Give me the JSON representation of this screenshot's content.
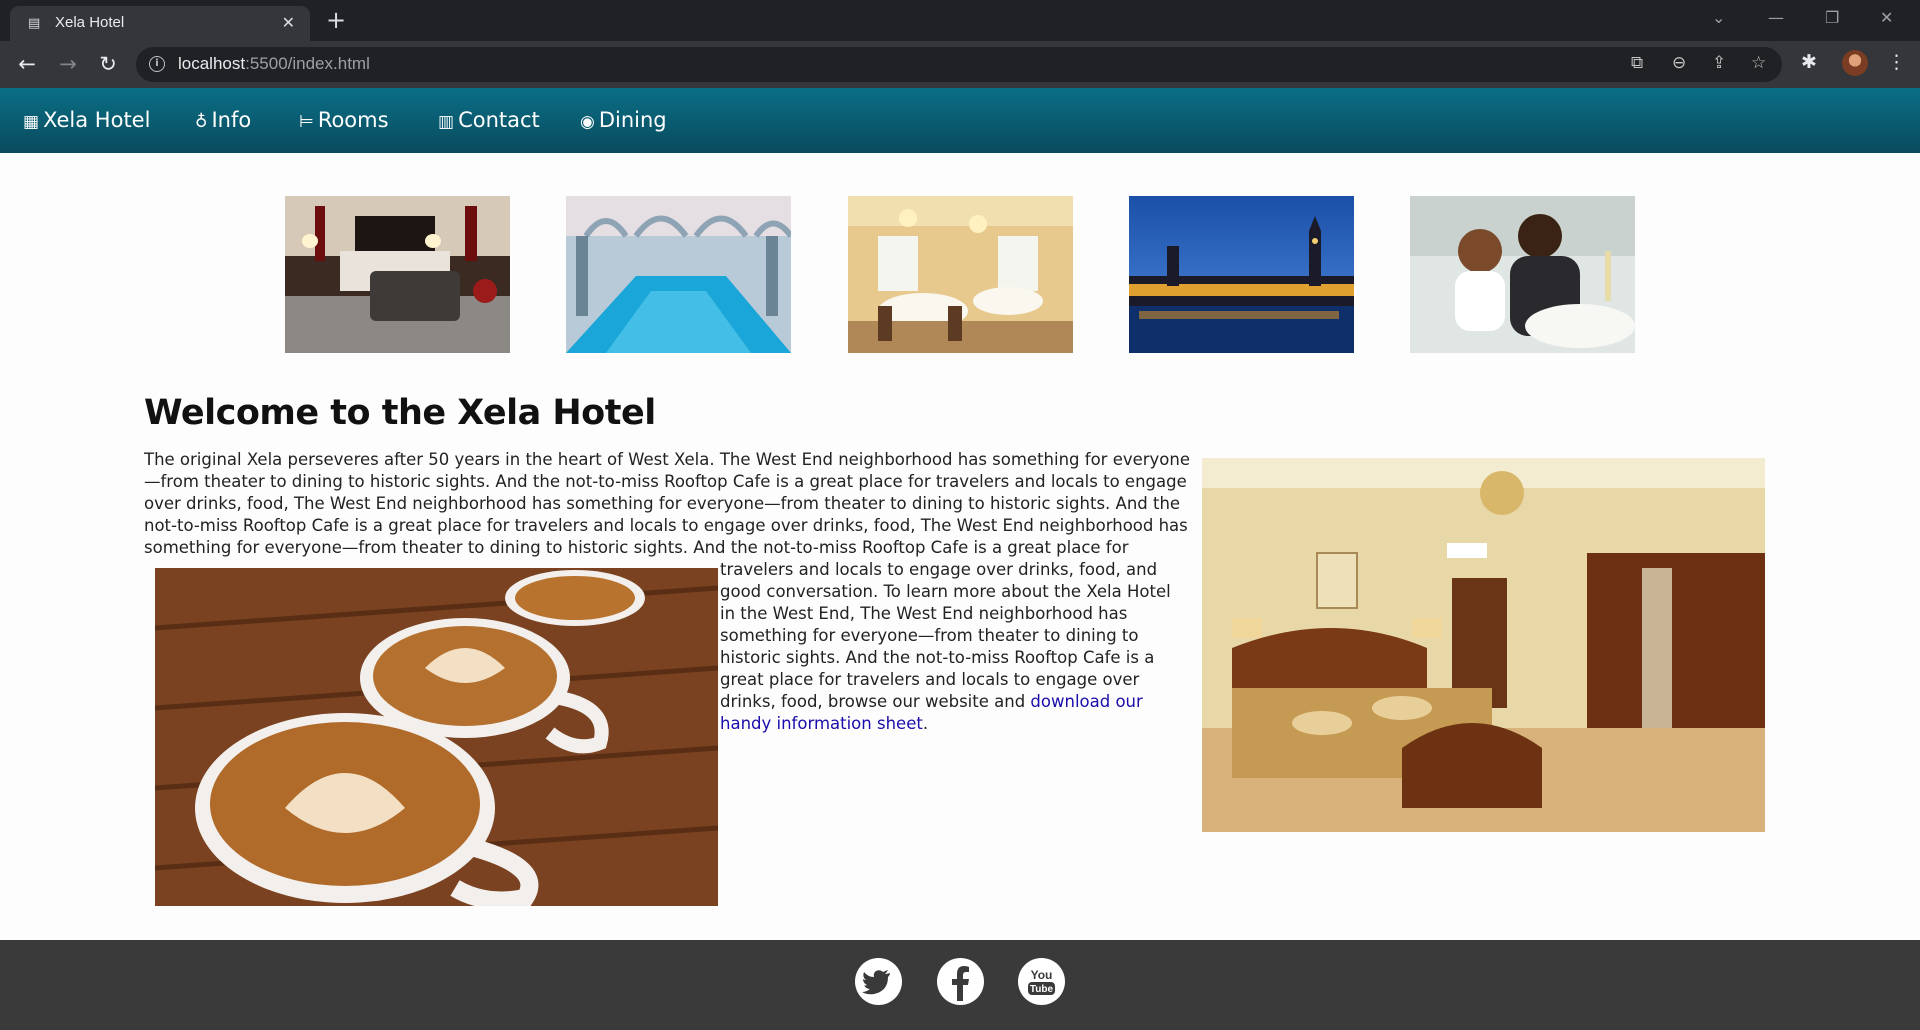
{
  "browser": {
    "tab_title": "Xela Hotel",
    "url_host": "localhost",
    "url_rest": ":5500/index.html"
  },
  "nav": {
    "items": [
      {
        "label": "Xela Hotel",
        "icon": "hotel-icon"
      },
      {
        "label": "Info",
        "icon": "info-icon"
      },
      {
        "label": "Rooms",
        "icon": "bed-icon"
      },
      {
        "label": "Contact",
        "icon": "calendar-icon"
      },
      {
        "label": "Dining",
        "icon": "plate-icon"
      }
    ]
  },
  "gallery": [
    "hotel-room-photo",
    "indoor-pool-photo",
    "dining-room-photo",
    "london-parliament-photo",
    "couple-dining-photo"
  ],
  "main": {
    "heading": "Welcome to the Xela Hotel",
    "paragraph": "The original Xela perseveres after 50 years in the heart of West Xela. The West End neighborhood has something for everyone—from theater to dining to historic sights. And the not-to-miss Rooftop Cafe is a great place for travelers and locals to engage over drinks, food, The West End neighborhood has something for everyone—from theater to dining to historic sights. And the not-to-miss Rooftop Cafe is a great place for travelers and locals to engage over drinks, food, The West End neighborhood has something for everyone—from theater to dining to historic sights. And the not-to-miss Rooftop Cafe is a great place for travelers and locals to engage over drinks, food, and good conversation.  To learn more about the Xela Hotel in the West End, The West End neighborhood has something for everyone—from theater to dining to historic sights. And the not-to-miss Rooftop Cafe is a great place for travelers and locals to engage over drinks, food, browse our website and ",
    "link_text": "download our handy information sheet",
    "after_link": "."
  },
  "footer": {
    "social": [
      "twitter-icon",
      "facebook-icon",
      "youtube-icon"
    ],
    "youtube_text": [
      "You",
      "Tube"
    ]
  },
  "colors": {
    "nav_top": "#0a6f86",
    "nav_bottom": "#0a4a5d",
    "footer": "#3a3a3a",
    "link": "#1a0dab"
  }
}
